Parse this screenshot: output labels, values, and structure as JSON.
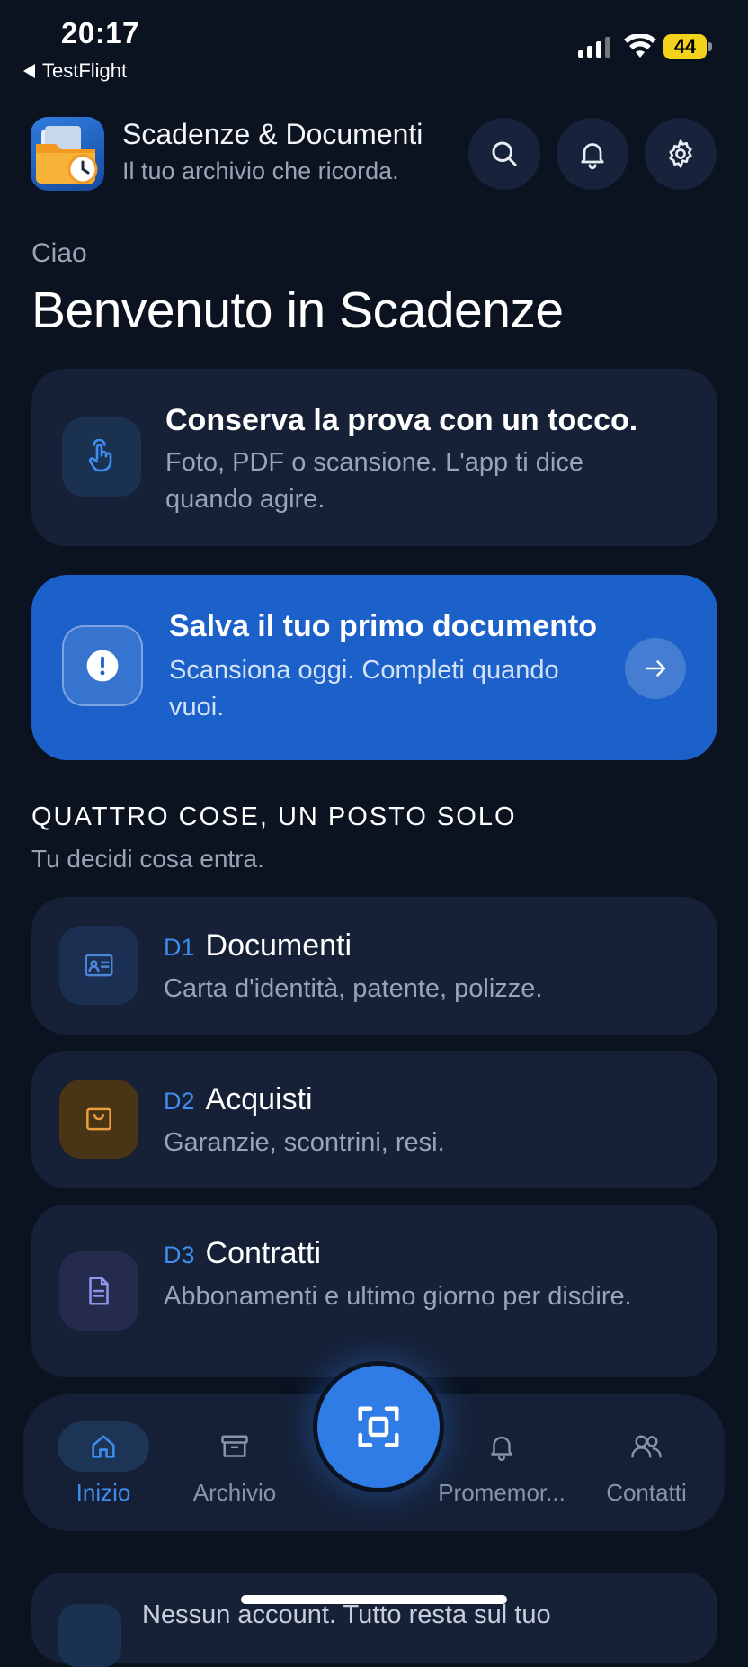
{
  "status": {
    "time": "20:17",
    "back_label": "TestFlight",
    "battery": "44"
  },
  "header": {
    "title": "Scadenze & Documenti",
    "subtitle": "Il tuo archivio che ricorda."
  },
  "greeting": {
    "hello": "Ciao",
    "welcome": "Benvenuto in Scadenze"
  },
  "info_card": {
    "title": "Conserva la prova con un tocco.",
    "text": "Foto, PDF o scansione. L'app ti dice quando agire."
  },
  "cta_card": {
    "title": "Salva il tuo primo documento",
    "text": "Scansiona oggi. Completi quando vuoi."
  },
  "section": {
    "title": "QUATTRO COSE, UN POSTO SOLO",
    "subtitle": "Tu decidi cosa entra."
  },
  "categories": [
    {
      "code": "D1",
      "title": "Documenti",
      "text": "Carta d'identità, patente, polizze.",
      "color": "#4c84d6",
      "bg": "#1b2f52"
    },
    {
      "code": "D2",
      "title": "Acquisti",
      "text": "Garanzie, scontrini, resi.",
      "color": "#e8a03a",
      "bg": "#4a3416"
    },
    {
      "code": "D3",
      "title": "Contratti",
      "text": "Abbonamenti e ultimo giorno per disdire.",
      "color": "#8d96ea",
      "bg": "#242b4c"
    }
  ],
  "tabs": [
    {
      "label": "Inizio",
      "active": true
    },
    {
      "label": "Archivio"
    },
    {
      "label": "Promemor..."
    },
    {
      "label": "Contatti"
    }
  ],
  "bottom_card": {
    "text": "Nessun account. Tutto resta sul tuo"
  },
  "colors": {
    "accent": "#2f7ce6",
    "background": "#0b1220",
    "card": "#162036",
    "cta": "#1c61c9"
  }
}
